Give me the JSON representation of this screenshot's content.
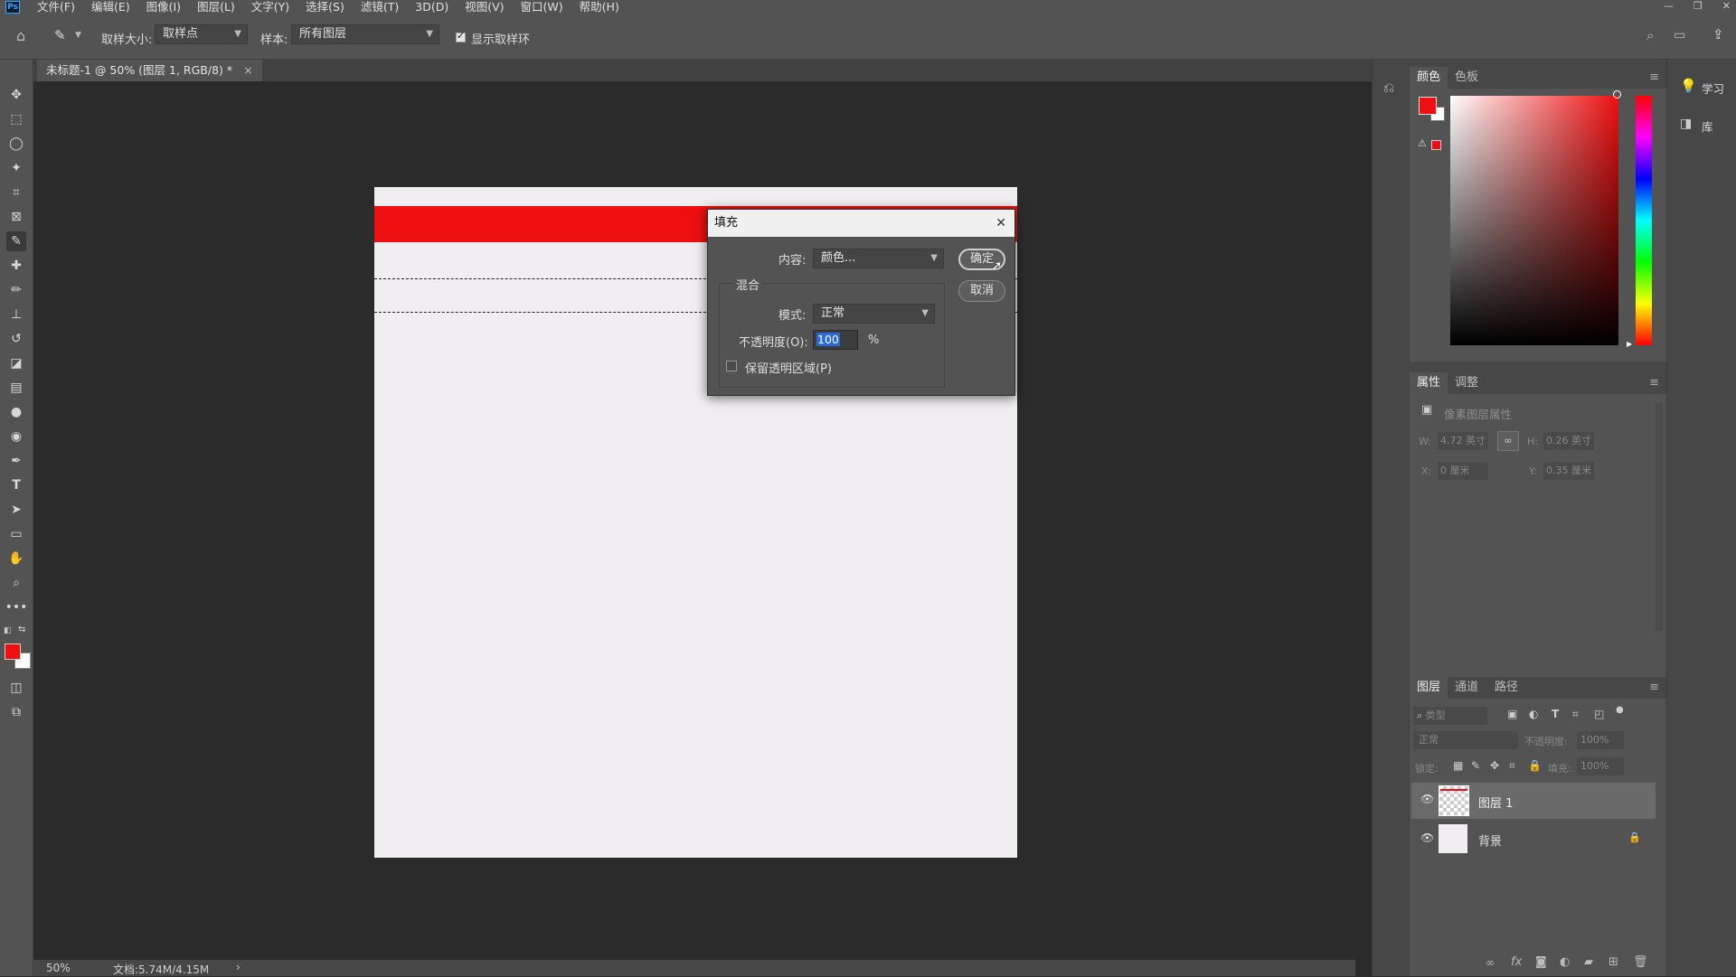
{
  "app": {
    "logo": "Ps"
  },
  "menu": [
    "文件(F)",
    "编辑(E)",
    "图像(I)",
    "图层(L)",
    "文字(Y)",
    "选择(S)",
    "滤镜(T)",
    "3D(D)",
    "视图(V)",
    "窗口(W)",
    "帮助(H)"
  ],
  "options": {
    "sample_size_label": "取样大小:",
    "sample_size_value": "取样点",
    "sample_label": "样本:",
    "sample_value": "所有图层",
    "show_ring_label": "显示取样环",
    "show_ring_checked": true
  },
  "document": {
    "tab_title": "未标题-1 @ 50% (图层 1, RGB/8) *",
    "close": "×"
  },
  "status": {
    "zoom": "50%",
    "doc_info": "文档:5.74M/4.15M",
    "arrow": "›"
  },
  "dialog": {
    "title": "填充",
    "close": "✕",
    "content_label": "内容:",
    "content_value": "颜色...",
    "blend_group": "混合",
    "mode_label": "模式:",
    "mode_value": "正常",
    "opacity_label": "不透明度(O):",
    "opacity_value": "100",
    "opacity_unit": "%",
    "preserve_label": "保留透明区域(P)",
    "preserve_checked": false,
    "ok": "确定",
    "cancel": "取消"
  },
  "color_panel": {
    "tabs": [
      "颜色",
      "色板"
    ],
    "foreground": "#ee1010",
    "background": "#ffffff"
  },
  "properties_panel": {
    "tabs": [
      "属性",
      "调整"
    ],
    "subtitle": "像素图层属性",
    "w_label": "W:",
    "w_value": "4.72 英寸",
    "h_label": "H:",
    "h_value": "0.26 英寸",
    "x_label": "X:",
    "x_value": "0 厘米",
    "y_label": "Y:",
    "y_value": "0.35 厘米"
  },
  "layers_panel": {
    "tabs": [
      "图层",
      "通道",
      "路径"
    ],
    "filter_placeholder": "类型",
    "blend_mode": "正常",
    "opacity_label": "不透明度:",
    "opacity_value": "100%",
    "lock_label": "锁定:",
    "fill_label": "填充:",
    "fill_value": "100%",
    "layers": [
      {
        "name": "图层 1",
        "selected": true,
        "locked": false
      },
      {
        "name": "背景",
        "selected": false,
        "locked": true
      }
    ]
  },
  "learn_panel": {
    "learn": "学习",
    "library": "库"
  },
  "colors": {
    "accent": "#31a8ff",
    "red": "#ee1010"
  }
}
